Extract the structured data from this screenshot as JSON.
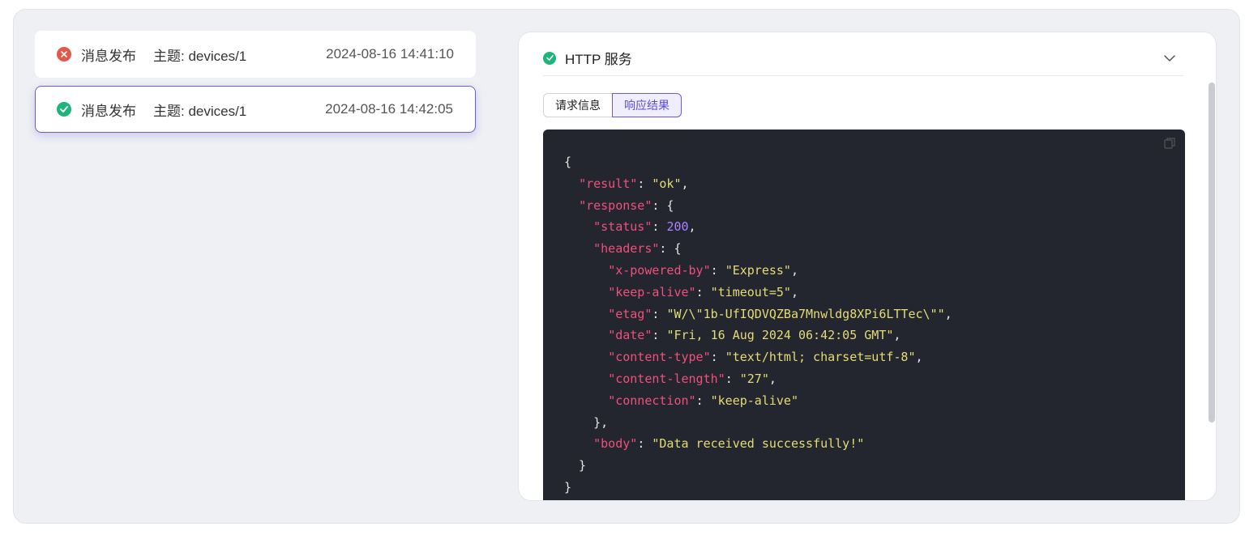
{
  "events": [
    {
      "status": "error",
      "type": "消息发布",
      "topic": "主题: devices/1",
      "time": "2024-08-16 14:41:10"
    },
    {
      "status": "success",
      "type": "消息发布",
      "topic": "主题: devices/1",
      "time": "2024-08-16 14:42:05"
    }
  ],
  "panel": {
    "title": "HTTP 服务",
    "tabs": [
      "请求信息",
      "响应结果"
    ],
    "active_tab": "响应结果",
    "code": {
      "open": "{",
      "result_key": "\"result\"",
      "result_val": "\"ok\"",
      "response_key": "\"response\"",
      "status_key": "\"status\"",
      "status_val": "200",
      "headers_key": "\"headers\"",
      "h1_key": "\"x-powered-by\"",
      "h1_val": "\"Express\"",
      "h2_key": "\"keep-alive\"",
      "h2_val": "\"timeout=5\"",
      "h3_key": "\"etag\"",
      "h3_val": "\"W/\\\"1b-UfIQDVQZBa7Mnwldg8XPi6LTTec\\\"\"",
      "h4_key": "\"date\"",
      "h4_val": "\"Fri, 16 Aug 2024 06:42:05 GMT\"",
      "h5_key": "\"content-type\"",
      "h5_val": "\"text/html; charset=utf-8\"",
      "h6_key": "\"content-length\"",
      "h6_val": "\"27\"",
      "h7_key": "\"connection\"",
      "h7_val": "\"keep-alive\"",
      "body_key": "\"body\"",
      "body_val": "\"Data received successfully!\"",
      "close": "}"
    }
  },
  "colors": {
    "accent": "#6a5ae0",
    "success": "#1eb47a",
    "error": "#e45849",
    "code_bg": "#23262e",
    "code_key": "#f0507a",
    "code_string": "#e6db74",
    "code_number": "#ae81ff"
  },
  "icons": {
    "error": "close-circle-icon",
    "success": "check-circle-icon",
    "collapse": "chevron-down-icon",
    "copy": "copy-icon"
  }
}
